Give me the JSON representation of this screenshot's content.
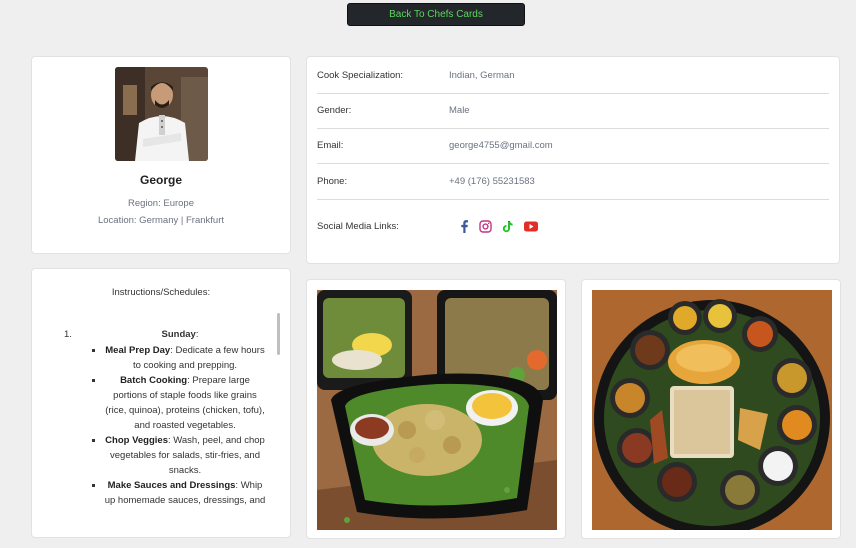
{
  "back_button": {
    "label": "Back To Chefs Cards"
  },
  "profile": {
    "name": "George",
    "region": "Region: Europe",
    "location": "Location: Germany | Frankfurt"
  },
  "details": [
    {
      "label": "Cook Specialization:",
      "value": "Indian, German"
    },
    {
      "label": "Gender:",
      "value": "Male"
    },
    {
      "label": "Email:",
      "value": "george4755@gmail.com"
    },
    {
      "label": "Phone:",
      "value": "+49 (176) 55231583"
    }
  ],
  "social": {
    "label": "Social Media Links:",
    "icons": [
      "facebook-icon",
      "instagram-icon",
      "tiktok-icon",
      "youtube-icon"
    ],
    "colors": {
      "facebook": "#3b5998",
      "instagram": "#c13584",
      "tiktok": "#25c22b",
      "youtube": "#e52d27"
    }
  },
  "instructions": {
    "title": "Instructions/Schedules:",
    "day_number": "1.",
    "day": "Sunday",
    "day_suffix": ":",
    "tasks": [
      {
        "title": "Meal Prep Day",
        "text": ": Dedicate a few hours to cooking and prepping."
      },
      {
        "title": "Batch Cooking",
        "text": ": Prepare large portions of staple foods like grains (rice, quinoa), proteins (chicken, tofu), and roasted vegetables."
      },
      {
        "title": "Chop Veggies",
        "text": ": Wash, peel, and chop vegetables for salads, stir-fries, and snacks."
      },
      {
        "title": "Make Sauces and Dressings",
        "text": ": Whip up homemade sauces, dressings, and"
      }
    ]
  },
  "colors": {
    "button_bg": "#23272b",
    "button_text": "#5cd65c",
    "page_bg": "#efefef"
  }
}
